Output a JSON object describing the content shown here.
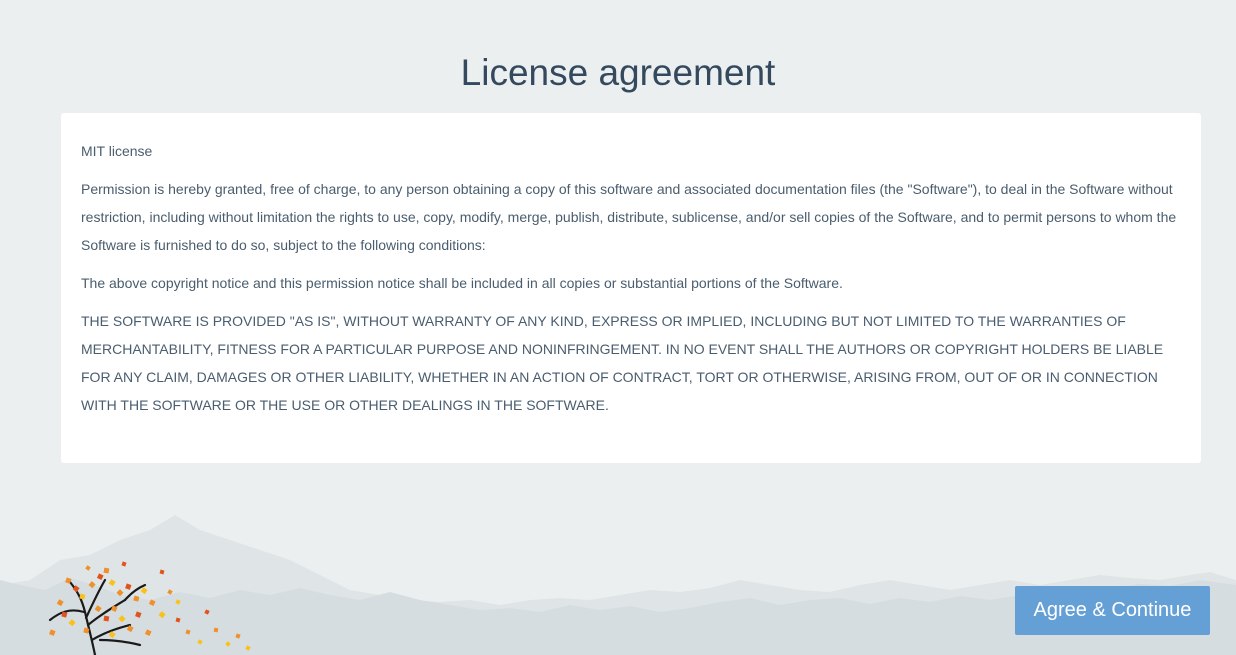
{
  "page": {
    "title": "License agreement"
  },
  "license": {
    "heading": "MIT license",
    "paragraphs": [
      "Permission is hereby granted, free of charge, to any person obtaining a copy of this software and associated documentation files (the \"Software\"), to deal in the Software without restriction, including without limitation the rights to use, copy, modify, merge, publish, distribute, sublicense, and/or sell copies of the Software, and to permit persons to whom the Software is furnished to do so, subject to the following conditions:",
      "The above copyright notice and this permission notice shall be included in all copies or substantial portions of the Software.",
      "THE SOFTWARE IS PROVIDED \"AS IS\", WITHOUT WARRANTY OF ANY KIND, EXPRESS OR IMPLIED, INCLUDING BUT NOT LIMITED TO THE WARRANTIES OF MERCHANTABILITY, FITNESS FOR A PARTICULAR PURPOSE AND NONINFRINGEMENT. IN NO EVENT SHALL THE AUTHORS OR COPYRIGHT HOLDERS BE LIABLE FOR ANY CLAIM, DAMAGES OR OTHER LIABILITY, WHETHER IN AN ACTION OF CONTRACT, TORT OR OTHERWISE, ARISING FROM, OUT OF OR IN CONNECTION WITH THE SOFTWARE OR THE USE OR OTHER DEALINGS IN THE SOFTWARE."
    ]
  },
  "actions": {
    "agree_label": "Agree & Continue"
  },
  "colors": {
    "background": "#ebeff0",
    "title": "#34495e",
    "text": "#4a5d6e",
    "button": "#64a0d6",
    "mountain_far": "#dde3e5",
    "mountain_near": "#d3dadd",
    "leaf_orange": "#f0902a",
    "leaf_red": "#e0541c",
    "leaf_yellow": "#f8c21a"
  },
  "decor": {
    "illustration": "autumn-tree-and-mountains"
  }
}
